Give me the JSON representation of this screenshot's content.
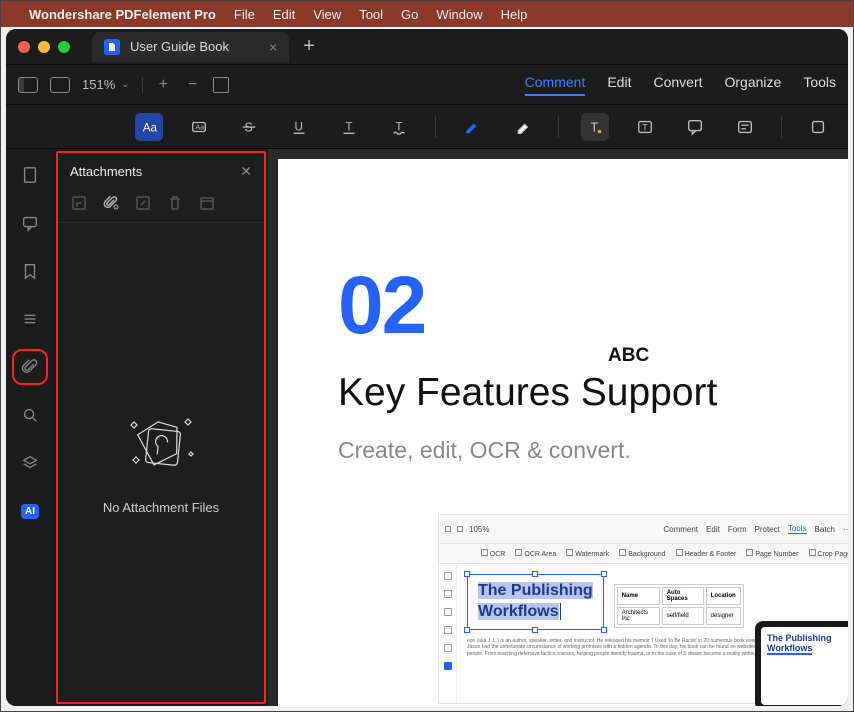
{
  "menubar": {
    "app_name": "Wondershare PDFelement Pro",
    "items": [
      "File",
      "Edit",
      "View",
      "Tool",
      "Go",
      "Window",
      "Help"
    ]
  },
  "tab": {
    "title": "User Guide Book"
  },
  "topbar": {
    "zoom": "151%",
    "tabs": [
      "Comment",
      "Edit",
      "Convert",
      "Organize",
      "Tools"
    ],
    "active_tab": "Comment"
  },
  "panel": {
    "title": "Attachments",
    "empty_message": "No Attachment Files"
  },
  "page": {
    "number": "02",
    "abc": "ABC",
    "heading": "Key Features Support",
    "subheading": "Create, edit, OCR & convert."
  },
  "embed": {
    "topnav": [
      "Comment",
      "Edit",
      "Form",
      "Protect",
      "Tools",
      "Batch"
    ],
    "subtools": [
      "OCR",
      "OCR Area",
      "Watermark",
      "Background",
      "Header & Footer",
      "Page Number",
      "Crop Page"
    ],
    "selected_text_line1": "The Publishing",
    "selected_text_line2": "Workflows",
    "table": {
      "headers": [
        "Name",
        "Auto Spaces",
        "Location"
      ],
      "row": [
        "Architects Inc",
        "self/field",
        "designer"
      ]
    },
    "lorem": "eon (aka J. L.) is an author, speaker, writer, and instructor. He released his memoir 'I Used To Be Racist' in 20 numerous book events. Prior to starting IOS Publishing, Jason had the unfortunate circumstance of working promises with a hidden agenda. To this day, his book can be found on websites he had no intentions of selling helping people. From teaching defensive tactics courses, helping people identify trauma, or in the case of S dream become a reality without a catch.",
    "tablet_text_l1": "The Publishing",
    "tablet_text_l2": "Workflows"
  },
  "ai_label": "AI"
}
